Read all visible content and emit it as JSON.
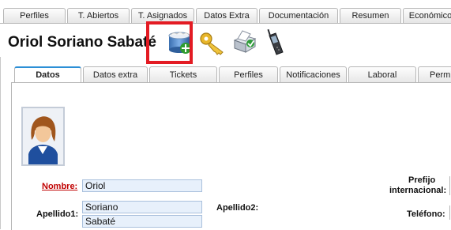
{
  "top_tabs": [
    "Perfiles",
    "T. Abiertos",
    "T. Asignados",
    "Datos Extra",
    "Documentación",
    "Resumen",
    "Económico"
  ],
  "page_title": "Oriol Soriano Sabaté",
  "toolbar_icons": [
    "add-database-icon",
    "key-icon",
    "printer-icon",
    "mobile-phone-icon"
  ],
  "highlight_color": "#e31b23",
  "inner_tabs": [
    "Datos",
    "Datos extra",
    "Tickets",
    "Perfiles",
    "Notificaciones",
    "Laboral",
    "Permi"
  ],
  "active_inner_tab": "Datos",
  "form": {
    "nombre_label": "Nombre:",
    "nombre_value": "Oriol",
    "apellido1_label": "Apellido1:",
    "apellido1_values": [
      "Soriano",
      "Sabaté"
    ],
    "apellido2_label": "Apellido2:",
    "prefijo_label_line1": "Prefijo",
    "prefijo_label_line2": "internacional:",
    "telefono_label": "Teléfono:"
  }
}
